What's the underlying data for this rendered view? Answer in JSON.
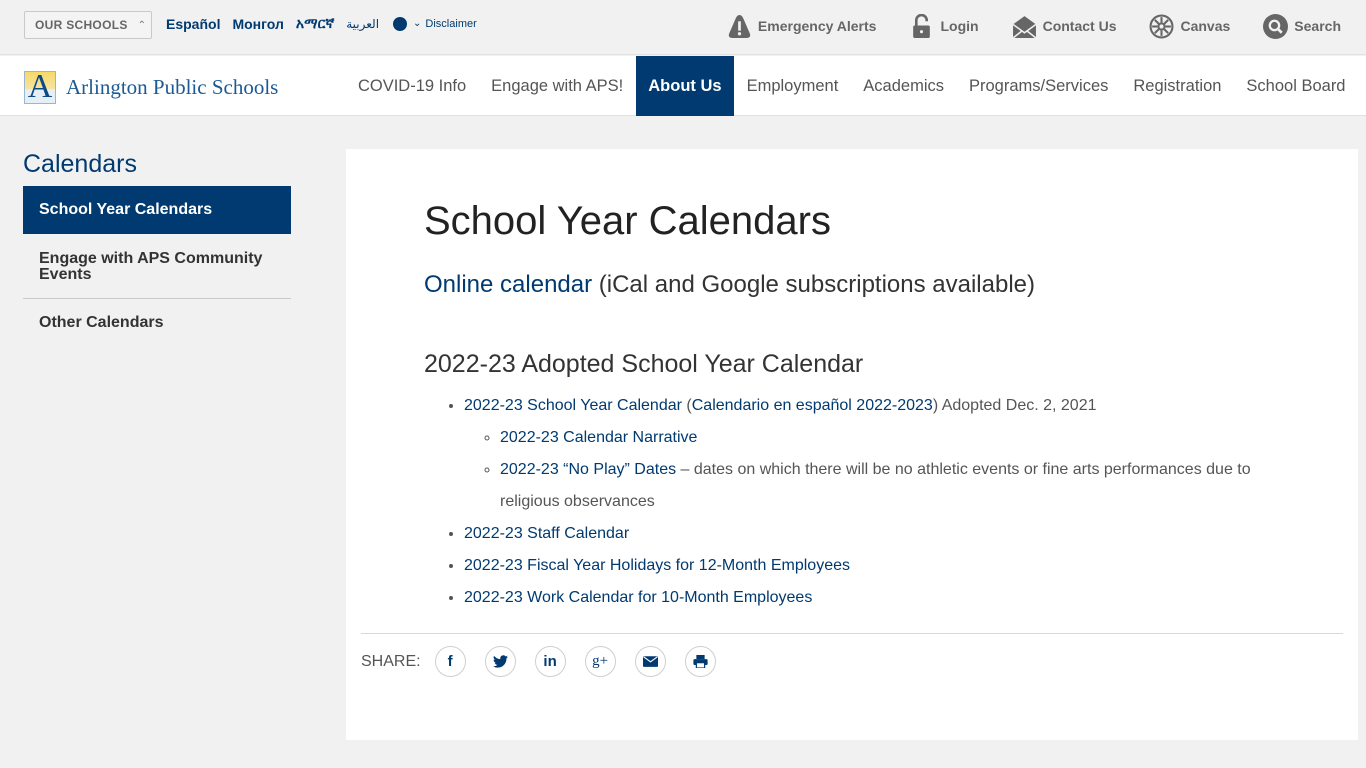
{
  "utility_bar": {
    "our_schools_label": "OUR SCHOOLS",
    "languages": [
      "Español",
      "Монгол",
      "አማርኛ",
      "العربية"
    ],
    "disclaimer_label": "Disclaimer",
    "links": [
      {
        "label": "Emergency Alerts",
        "icon": "warning-icon"
      },
      {
        "label": "Login",
        "icon": "lock-icon"
      },
      {
        "label": "Contact Us",
        "icon": "envelope-icon"
      },
      {
        "label": "Canvas",
        "icon": "canvas-icon"
      },
      {
        "label": "Search",
        "icon": "search-icon"
      }
    ]
  },
  "header": {
    "logo_letter": "A",
    "logo_text": "Arlington Public Schools",
    "nav": [
      "COVID-19 Info",
      "Engage with APS!",
      "About Us",
      "Employment",
      "Academics",
      "Programs/Services",
      "Registration",
      "School Board"
    ],
    "active_nav": "About Us"
  },
  "sidebar": {
    "title": "Calendars",
    "items": [
      "School Year Calendars",
      "Engage with APS Community Events",
      "Other Calendars"
    ]
  },
  "main": {
    "title": "School Year Calendars",
    "intro_link": "Online calendar",
    "intro_text": " (iCal and Google subscriptions available)",
    "section_title": "2022-23 Adopted School Year Calendar",
    "item1_link": "2022-23 School Year Calendar",
    "item1_paren_open": " (",
    "item1_link2": "Calendario en español 2022-2023",
    "item1_suffix": ") Adopted Dec. 2, 2021",
    "sub1_link": "2022-23 Calendar Narrative",
    "sub2_link": "2022-23 “No Play” Dates",
    "sub2_text": " – dates on which there will be no athletic events or fine arts performances due to religious observances",
    "items": [
      "2022-23 Staff Calendar",
      "2022-23 Fiscal Year Holidays for 12-Month Employees",
      "2022-23 Work Calendar for 10-Month Employees"
    ]
  },
  "share": {
    "label": "SHARE:",
    "buttons": [
      {
        "name": "facebook",
        "glyph": "f"
      },
      {
        "name": "twitter",
        "glyph": "🐦"
      },
      {
        "name": "linkedin",
        "glyph": "in"
      },
      {
        "name": "google-plus",
        "glyph": "g+"
      },
      {
        "name": "email",
        "glyph": "✉"
      },
      {
        "name": "print",
        "glyph": "⎙"
      }
    ]
  },
  "colors": {
    "brand": "#003a70",
    "background": "#f1f1f1"
  }
}
